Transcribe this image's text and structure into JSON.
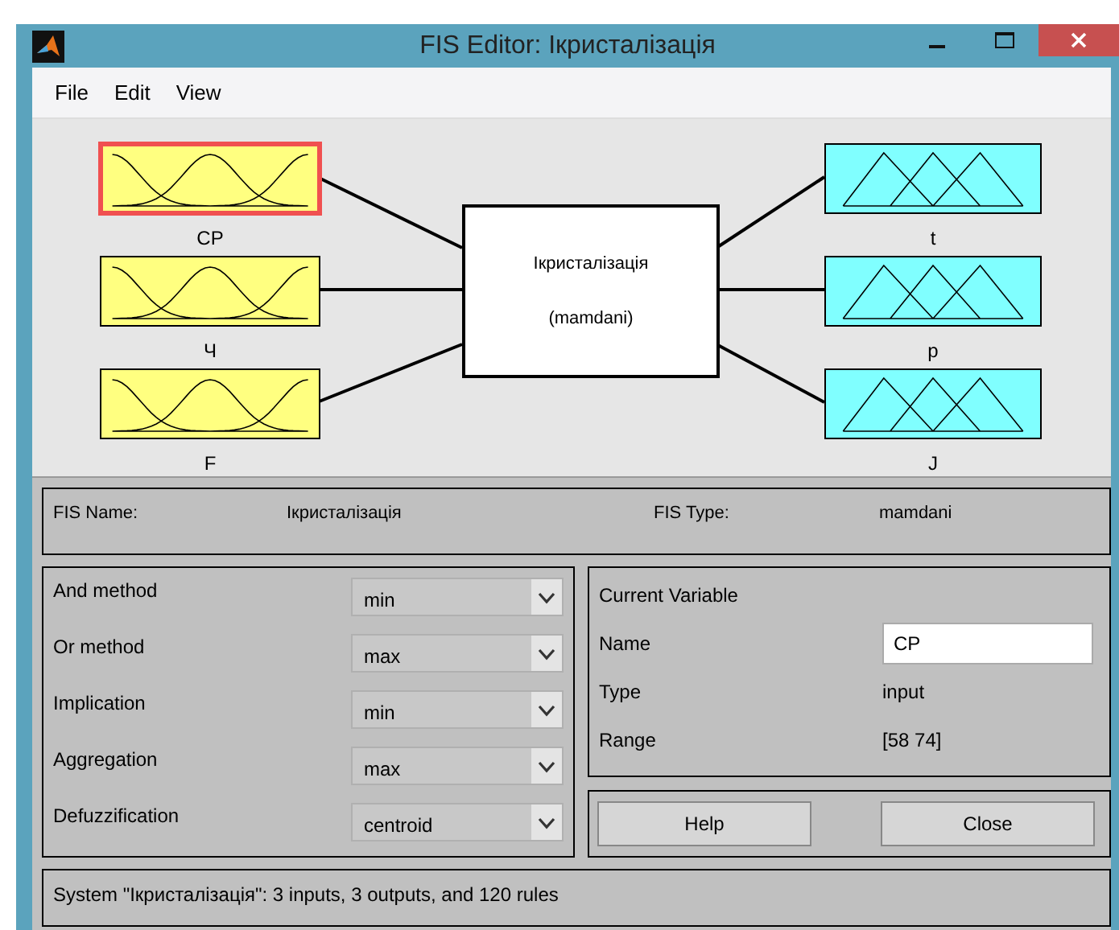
{
  "window": {
    "title": "FIS Editor: Ікристалізація"
  },
  "menu": [
    "File",
    "Edit",
    "View"
  ],
  "inputs": [
    {
      "name": "CP",
      "selected": true
    },
    {
      "name": "Ч",
      "selected": false
    },
    {
      "name": "F",
      "selected": false
    }
  ],
  "system": {
    "name": "Ікристалізація",
    "type": "(mamdani)"
  },
  "outputs": [
    {
      "name": "t",
      "selected": false
    },
    {
      "name": "p",
      "selected": false
    },
    {
      "name": "J",
      "selected": false
    }
  ],
  "info": {
    "fis_name_label": "FIS Name:",
    "fis_name": "Ікристалізація",
    "fis_type_label": "FIS Type:",
    "fis_type": "mamdani"
  },
  "methods": [
    {
      "label": "And method",
      "value": "min"
    },
    {
      "label": "Or method",
      "value": "max"
    },
    {
      "label": "Implication",
      "value": "min"
    },
    {
      "label": "Aggregation",
      "value": "max"
    },
    {
      "label": "Defuzzification",
      "value": "centroid"
    }
  ],
  "current_variable": {
    "title": "Current Variable",
    "name_label": "Name",
    "name": "CP",
    "type_label": "Type",
    "type": "input",
    "range_label": "Range",
    "range": "[58 74]"
  },
  "buttons": [
    "Help",
    "Close"
  ],
  "status": "System \"Ікристалізація\": 3 inputs, 3 outputs, and 120 rules"
}
